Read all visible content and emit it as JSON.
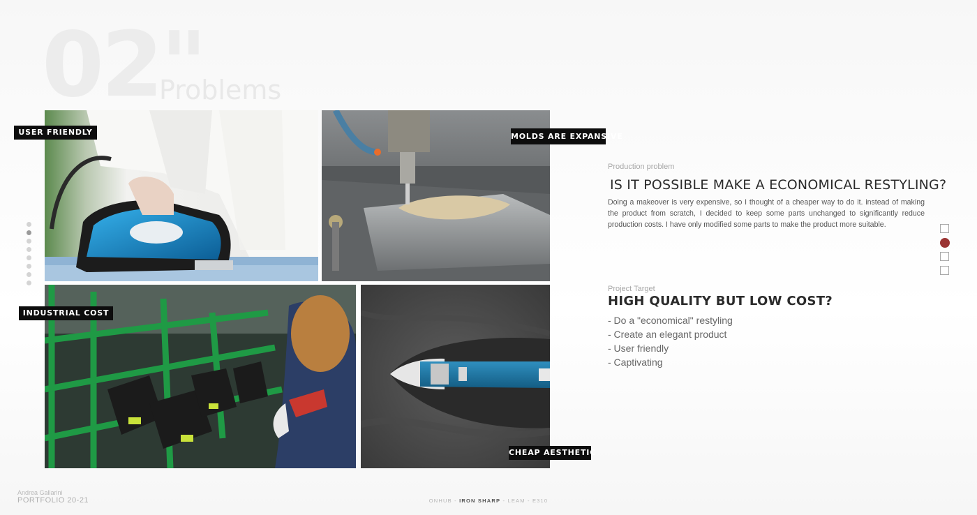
{
  "heading": {
    "number": "02\"",
    "word": "Problems"
  },
  "labels": {
    "user_friendly": "USER FRIENDLY",
    "molds": "MOLDS ARE EXPANSIVE",
    "industrial": "INDUSTRIAL COST",
    "cheap": "CHEAP AESTHETIC"
  },
  "production": {
    "label": "Production problem",
    "question": "IS IT POSSIBLE MAKE A ECONOMICAL RESTYLING?",
    "description": "Doing a makeover is very expensive, so I thought of a cheaper way to do it. instead of making the product from scratch, I decided to keep some parts unchanged to significantly reduce production costs. I have only modified some parts to make the product more suitable."
  },
  "target": {
    "label": "Project Target",
    "title": "HIGH QUALITY BUT LOW COST?",
    "bullets": [
      "- Do a \"economical\" restyling",
      "- Create an elegant product",
      "- User friendly",
      "- Captivating"
    ]
  },
  "footer": {
    "author": "Andrea Gallarini",
    "portfolio": "PORTFOLIO 20-21",
    "nav_pre": "ONHUB - ",
    "nav_current": "IRON SHARP",
    "nav_post": " - LEAM - E310"
  },
  "colors": {
    "accent": "#9b3433",
    "label_bg": "#0d0d0d",
    "iron_blue": "#1e88c7",
    "factory_green": "#1f8a3d"
  }
}
